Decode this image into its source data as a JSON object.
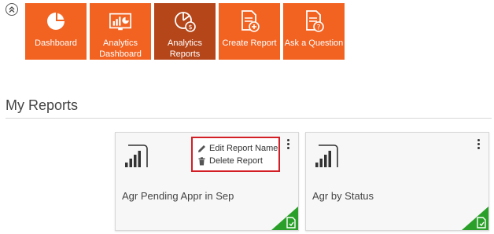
{
  "nav": {
    "collapse": "collapse-nav",
    "tiles": [
      {
        "label": "Dashboard",
        "icon": "pie-chart-icon"
      },
      {
        "label": "Analytics Dashboard",
        "icon": "analytics-dashboard-icon"
      },
      {
        "label": "Analytics Reports",
        "icon": "analytics-reports-icon",
        "active": true
      },
      {
        "label": "Create Report",
        "icon": "create-report-icon"
      },
      {
        "label": "Ask a Question",
        "icon": "ask-question-icon"
      }
    ],
    "tile_color": "#f26322",
    "active_tile_color": "#b5461a"
  },
  "section": {
    "title": "My Reports"
  },
  "reports": [
    {
      "name": "Agr Pending Appr in Sep",
      "icon": "power-bi-icon"
    },
    {
      "name": "Agr by Status",
      "icon": "power-bi-icon"
    }
  ],
  "context_menu": {
    "items": [
      {
        "label": "Edit Report Name",
        "icon": "pencil-icon"
      },
      {
        "label": "Delete Report",
        "icon": "trash-icon"
      }
    ],
    "highlight_color": "#d21f26"
  },
  "corner_badge_color": "#2aa02a"
}
